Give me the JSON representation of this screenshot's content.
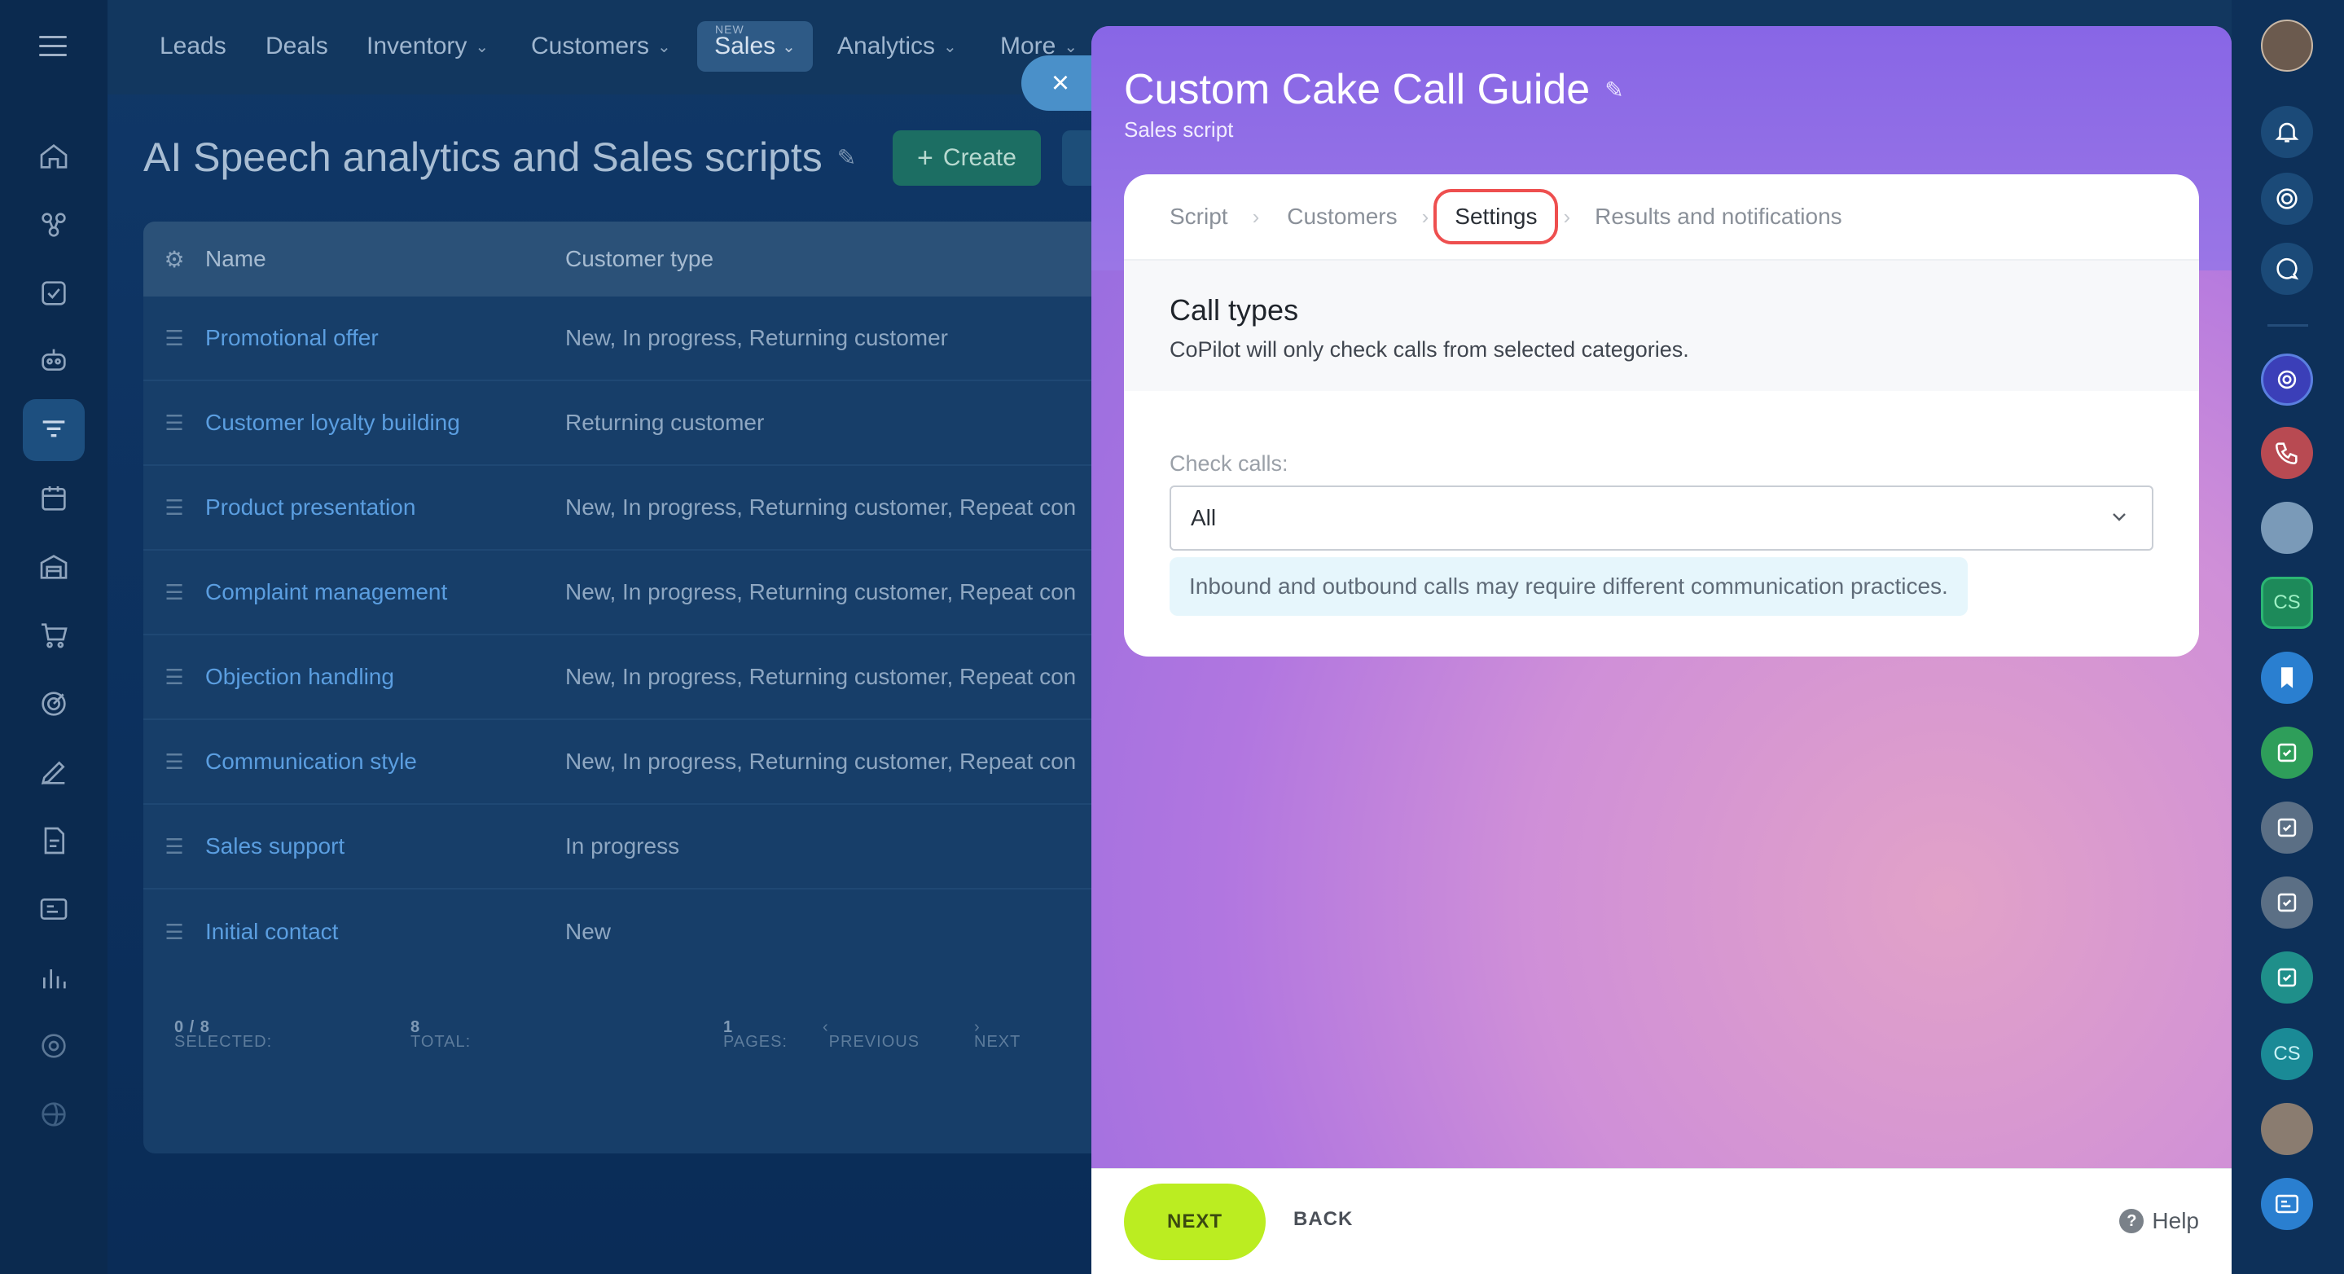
{
  "topnav": {
    "items": [
      "Leads",
      "Deals",
      "Inventory",
      "Customers"
    ],
    "sales": {
      "label": "Sales",
      "badge": "NEW"
    },
    "analytics": "Analytics",
    "more": "More"
  },
  "page": {
    "title": "AI Speech analytics and Sales scripts",
    "create_label": "Create"
  },
  "table": {
    "columns": [
      "Name",
      "Customer type"
    ],
    "rows": [
      {
        "name": "Promotional offer",
        "type": "New, In progress, Returning customer"
      },
      {
        "name": "Customer loyalty building",
        "type": "Returning customer"
      },
      {
        "name": "Product presentation",
        "type": "New, In progress, Returning customer, Repeat con"
      },
      {
        "name": "Complaint management",
        "type": "New, In progress, Returning customer, Repeat con"
      },
      {
        "name": "Objection handling",
        "type": "New, In progress, Returning customer, Repeat con"
      },
      {
        "name": "Communication style",
        "type": "New, In progress, Returning customer, Repeat con"
      },
      {
        "name": "Sales support",
        "type": "In progress"
      },
      {
        "name": "Initial contact",
        "type": "New"
      }
    ],
    "footer": {
      "selected_label": "SELECTED:",
      "selected_value": "0 / 8",
      "total_label": "TOTAL:",
      "total_value": "8",
      "pages_label": "PAGES:",
      "pages_value": "1",
      "previous": "PREVIOUS",
      "next": "NEXT"
    }
  },
  "slider": {
    "title": "Custom Cake Call Guide",
    "subtitle": "Sales script",
    "steps": [
      "Script",
      "Customers",
      "Settings",
      "Results and notifications"
    ],
    "active_step": "Settings",
    "section_title": "Call types",
    "section_desc": "CoPilot will only check calls from selected categories.",
    "field_label": "Check calls:",
    "field_value": "All",
    "hint": "Inbound and outbound calls may require different communication practices.",
    "next_label": "NEXT",
    "back_label": "BACK",
    "help_label": "Help"
  },
  "right_sidebar": {
    "cs_label": "CS"
  },
  "colors": {
    "accent_next": "#bbed21",
    "highlight_ring": "#ee4f4f",
    "link_blue": "#5b9ee0"
  }
}
